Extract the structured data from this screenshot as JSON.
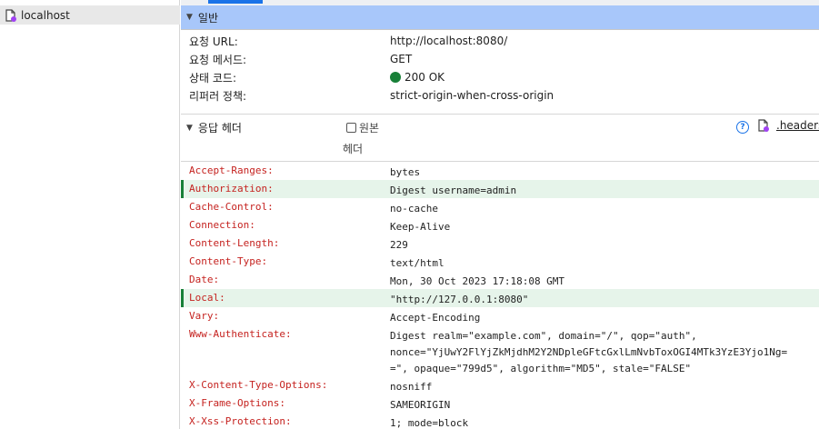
{
  "sidebar": {
    "items": [
      {
        "label": "localhost",
        "icon": "document-icon"
      }
    ]
  },
  "general": {
    "title": "일반",
    "rows": [
      {
        "key": "요청 URL:",
        "value": "http://localhost:8080/"
      },
      {
        "key": "요청 메서드:",
        "value": "GET"
      },
      {
        "key": "상태 코드:",
        "value": "200 OK",
        "status_color": "#188038"
      },
      {
        "key": "리퍼러 정책:",
        "value": "strict-origin-when-cross-origin"
      }
    ]
  },
  "response_headers": {
    "title": "응답 헤더",
    "raw_label_line1": "원본",
    "raw_label_line2": "헤더",
    "raw_checked": false,
    "headers_link": ".headers",
    "rows": [
      {
        "name": "Accept-Ranges:",
        "value": "bytes",
        "highlight": false
      },
      {
        "name": "Authorization:",
        "value": "Digest username=admin",
        "highlight": true
      },
      {
        "name": "Cache-Control:",
        "value": "no-cache",
        "highlight": false
      },
      {
        "name": "Connection:",
        "value": "Keep-Alive",
        "highlight": false
      },
      {
        "name": "Content-Length:",
        "value": "229",
        "highlight": false
      },
      {
        "name": "Content-Type:",
        "value": "text/html",
        "highlight": false
      },
      {
        "name": "Date:",
        "value": "Mon, 30 Oct 2023 17:18:08 GMT",
        "highlight": false
      },
      {
        "name": "Local:",
        "value": "\"http://127.0.0.1:8080\"",
        "highlight": true
      },
      {
        "name": "Vary:",
        "value": "Accept-Encoding",
        "highlight": false
      },
      {
        "name": "Www-Authenticate:",
        "value": "Digest realm=\"example.com\", domain=\"/\", qop=\"auth\",\nnonce=\"YjUwY2FlYjZkMjdhM2Y2NDpleGFtcGxlLmNvbToxOGI4MTk3YzE3Yjo1Ng=\n=\", opaque=\"799d5\", algorithm=\"MD5\", stale=\"FALSE\"",
        "highlight": false
      },
      {
        "name": "X-Content-Type-Options:",
        "value": "nosniff",
        "highlight": false
      },
      {
        "name": "X-Frame-Options:",
        "value": "SAMEORIGIN",
        "highlight": false
      },
      {
        "name": "X-Xss-Protection:",
        "value": "1; mode=block",
        "highlight": false
      }
    ]
  },
  "colors": {
    "accent": "#1a73e8",
    "section_bg": "#a8c7fa",
    "header_name": "#c5221f",
    "highlight_bg": "#e6f4ea",
    "highlight_bar": "#188038"
  }
}
